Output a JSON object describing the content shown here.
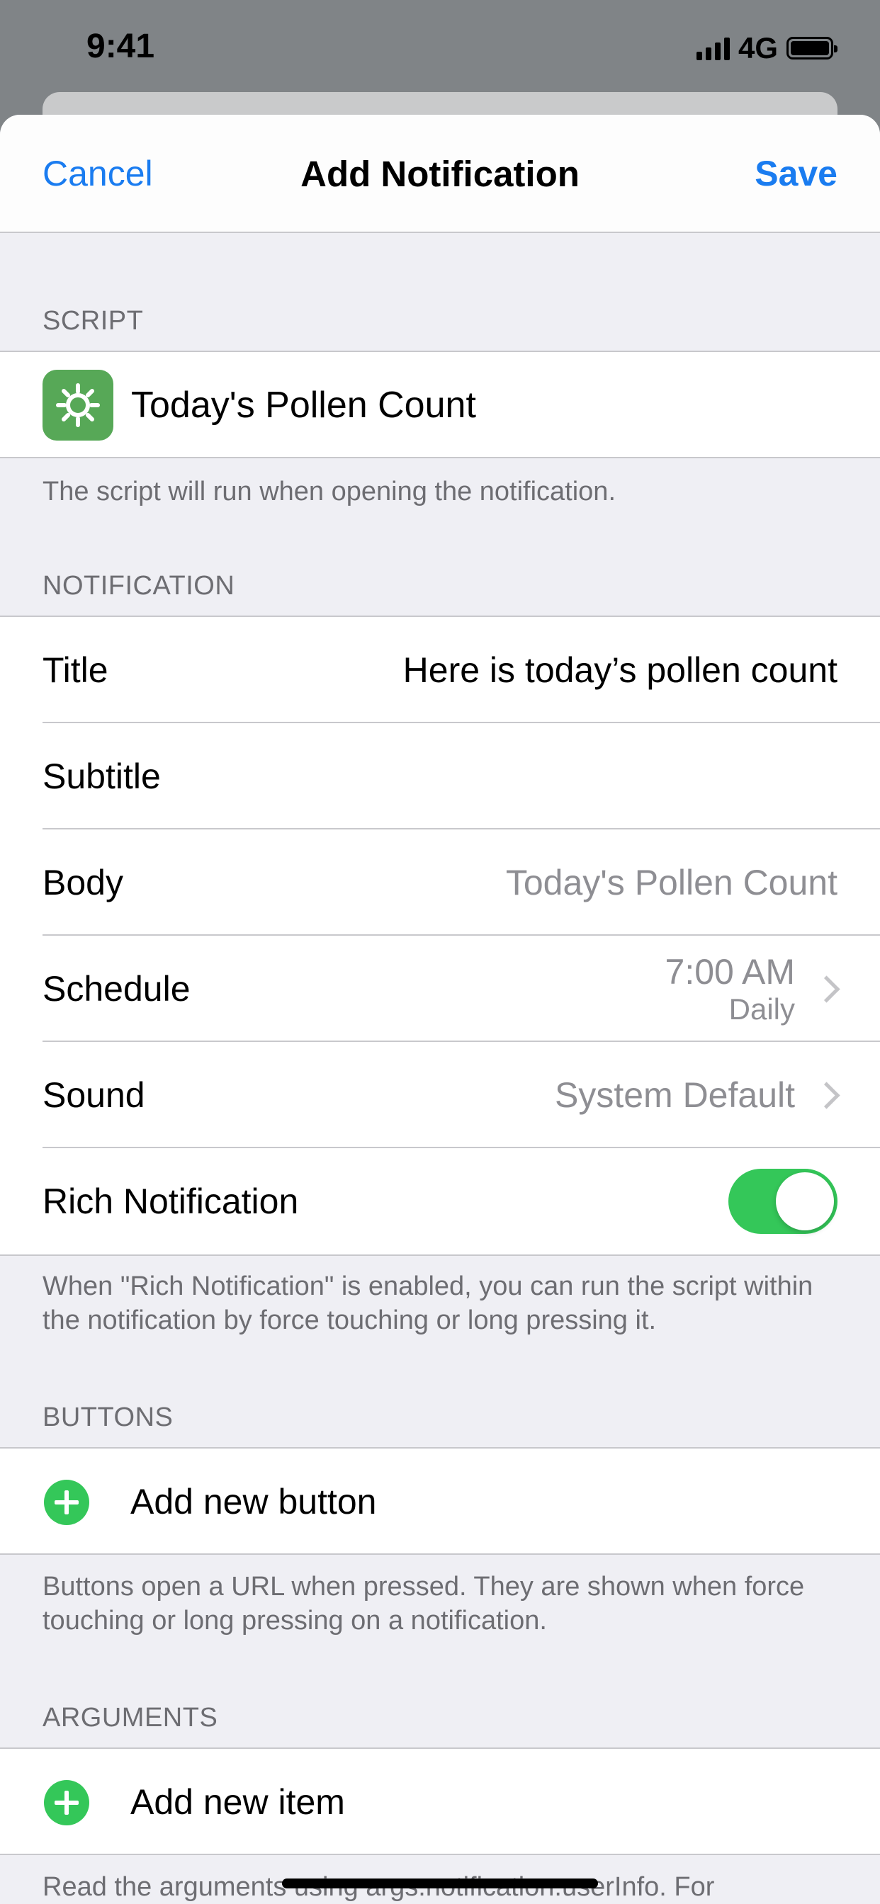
{
  "status": {
    "time": "9:41",
    "network": "4G"
  },
  "nav": {
    "cancel": "Cancel",
    "title": "Add Notification",
    "save": "Save"
  },
  "script_section": {
    "header": "SCRIPT",
    "script_name": "Today's Pollen Count",
    "icon_color": "#57a857",
    "footer": "The script will run when opening the notification."
  },
  "notification_section": {
    "header": "NOTIFICATION",
    "title_label": "Title",
    "title_value": "Here is today’s pollen count",
    "subtitle_label": "Subtitle",
    "subtitle_value": "",
    "body_label": "Body",
    "body_placeholder": "Today's Pollen Count",
    "schedule_label": "Schedule",
    "schedule_time": "7:00 AM",
    "schedule_repeat": "Daily",
    "sound_label": "Sound",
    "sound_value": "System Default",
    "rich_label": "Rich Notification",
    "rich_enabled": true,
    "footer": "When \"Rich Notification\" is enabled, you can run the script within the notification by force touching or long pressing it."
  },
  "buttons_section": {
    "header": "BUTTONS",
    "add_label": "Add new button",
    "footer": "Buttons open a URL when pressed. They are shown when force touching or long pressing on a notification."
  },
  "arguments_section": {
    "header": "ARGUMENTS",
    "add_label": "Add new item",
    "footer": "Read the arguments using args.notification.userInfo. For"
  },
  "colors": {
    "accent": "#1a7cf0",
    "toggle_on": "#34c759",
    "add_green": "#34c759"
  }
}
